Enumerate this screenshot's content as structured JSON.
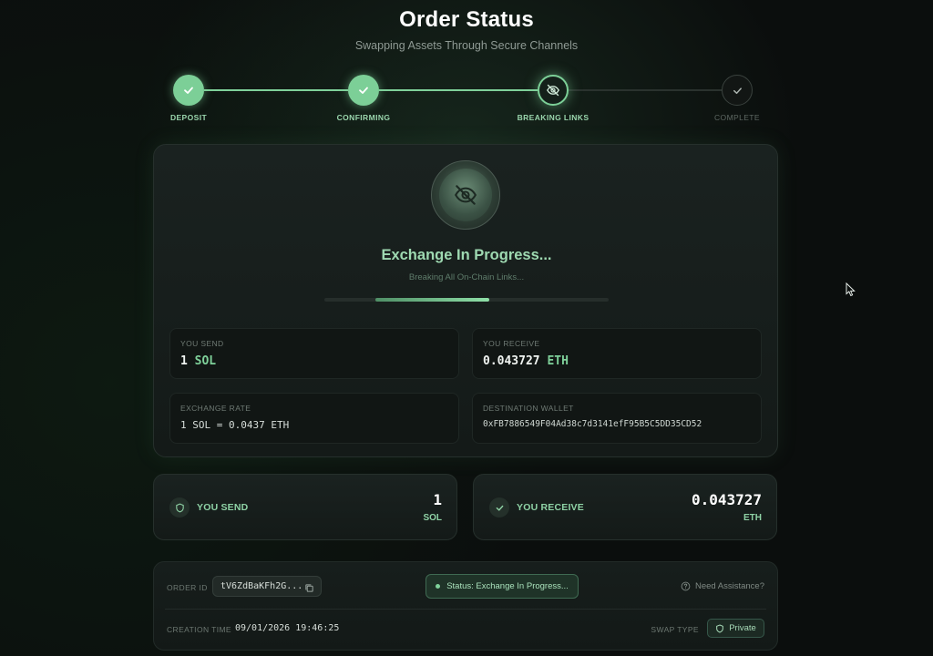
{
  "header": {
    "title": "Order Status",
    "subtitle": "Swapping Assets Through Secure Channels"
  },
  "stepper": {
    "steps": [
      {
        "label": "DEPOSIT",
        "state": "done",
        "icon": "check-icon"
      },
      {
        "label": "CONFIRMING",
        "state": "done",
        "icon": "check-icon"
      },
      {
        "label": "BREAKING LINKS",
        "state": "active",
        "icon": "eye-off-icon"
      },
      {
        "label": "COMPLETE",
        "state": "pending",
        "icon": "check-icon"
      }
    ]
  },
  "progress": {
    "title": "Exchange In Progress...",
    "subtitle": "Breaking All On-Chain Links...",
    "bar_start": 0.18,
    "bar_end": 0.58
  },
  "details": {
    "send": {
      "label": "YOU SEND",
      "amount": "1",
      "unit": "SOL"
    },
    "receive": {
      "label": "YOU RECEIVE",
      "amount": "0.043727",
      "unit": "ETH"
    },
    "rate": {
      "label": "EXCHANGE RATE",
      "value": "1 SOL = 0.0437 ETH"
    },
    "wallet": {
      "label": "DESTINATION WALLET",
      "value": "0xFB7886549F04Ad38c7d3141efF95B5C5DD35CD52"
    }
  },
  "summary": {
    "send": {
      "label": "YOU SEND",
      "amount": "1",
      "unit": "SOL",
      "icon": "shield-icon"
    },
    "receive": {
      "label": "YOU RECEIVE",
      "amount": "0.043727",
      "unit": "ETH",
      "icon": "check-icon"
    }
  },
  "order": {
    "id_label": "ORDER ID",
    "id_value": "tV6ZdBaKFh2G...",
    "status": "Status: Exchange In Progress...",
    "assistance": "Need Assistance?",
    "creation_label": "CREATION TIME",
    "creation_value": "09/01/2026 19:46:25",
    "swap_type_label": "SWAP TYPE",
    "swap_type_value": "Private"
  },
  "colors": {
    "accent": "#7fd19a",
    "background": "#0b0e0d",
    "card": "#161d1b"
  }
}
